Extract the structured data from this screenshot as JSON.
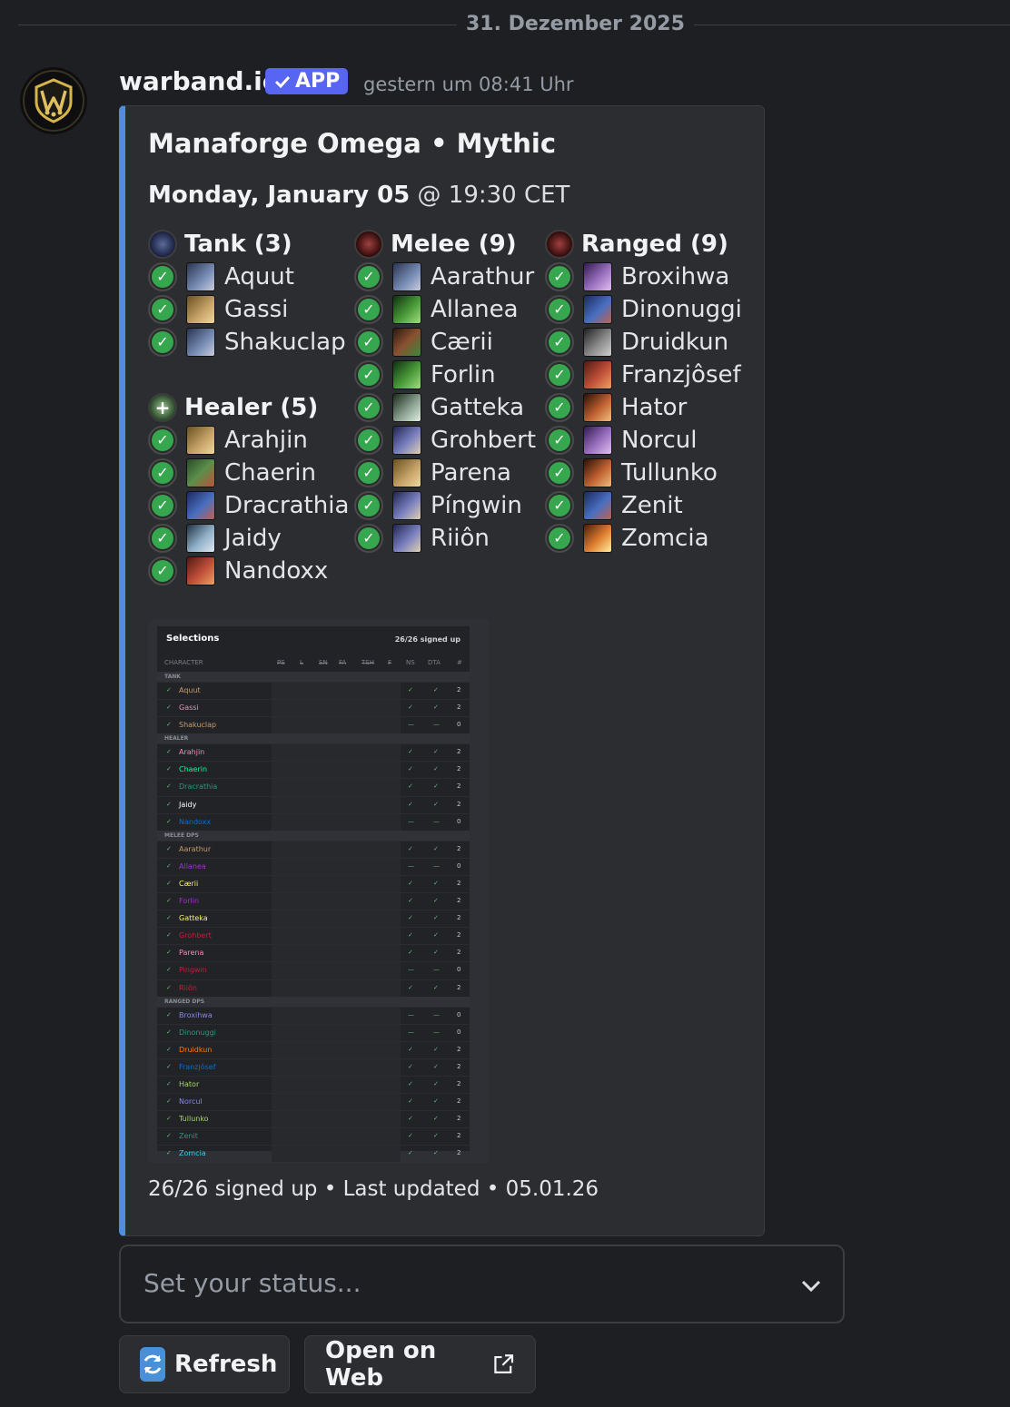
{
  "date_divider": "31. Dezember 2025",
  "message": {
    "author": "warband.io",
    "app_badge": "APP",
    "timestamp": "gestern um 08:41 Uhr"
  },
  "embed": {
    "accent_color": "#4e8ee0",
    "title": "Manaforge Omega • Mythic",
    "date_bold": "Monday, January 05",
    "date_rest": " @ 19:30 CET",
    "columns": [
      {
        "groups": [
          {
            "label": "Tank (3)",
            "icon": "shield-icon",
            "members": [
              {
                "name": "Aquut",
                "spec_color": "#7a8fb8"
              },
              {
                "name": "Gassi",
                "spec_color": "#c9a66b"
              },
              {
                "name": "Shakuclap",
                "spec_color": "#7a8fb8"
              }
            ]
          },
          {
            "label": "Healer (5)",
            "icon": "plus-icon",
            "members": [
              {
                "name": "Arahjin",
                "spec_color": "#c9a66b"
              },
              {
                "name": "Chaerin",
                "spec_color": "#5a8f4a"
              },
              {
                "name": "Dracrathia",
                "spec_color": "#4a6fc0"
              },
              {
                "name": "Jaidy",
                "spec_color": "#8fb0c8"
              },
              {
                "name": "Nandoxx",
                "spec_color": "#c0503a"
              }
            ]
          }
        ]
      },
      {
        "groups": [
          {
            "label": "Melee (9)",
            "icon": "sword-icon",
            "members": [
              {
                "name": "Aarathur",
                "spec_color": "#7a8fb8"
              },
              {
                "name": "Allanea",
                "spec_color": "#4a9a3a"
              },
              {
                "name": "Cærii",
                "spec_color": "#8a5030"
              },
              {
                "name": "Forlin",
                "spec_color": "#4a9a3a"
              },
              {
                "name": "Gatteka",
                "spec_color": "#8aa090"
              },
              {
                "name": "Grohbert",
                "spec_color": "#7a80c0"
              },
              {
                "name": "Parena",
                "spec_color": "#c9a66b"
              },
              {
                "name": "Píngwin",
                "spec_color": "#7a80c0"
              },
              {
                "name": "Riiôn",
                "spec_color": "#7a80c0"
              }
            ]
          }
        ]
      },
      {
        "groups": [
          {
            "label": "Ranged (9)",
            "icon": "staff-icon",
            "members": [
              {
                "name": "Broxihwa",
                "spec_color": "#9a70c0"
              },
              {
                "name": "Dinonuggi",
                "spec_color": "#4a6fc0"
              },
              {
                "name": "Druidkun",
                "spec_color": "#8a8a8a"
              },
              {
                "name": "Franzjôsef",
                "spec_color": "#c0503a"
              },
              {
                "name": "Hator",
                "spec_color": "#c06030"
              },
              {
                "name": "Norcul",
                "spec_color": "#9a70c0"
              },
              {
                "name": "Tullunko",
                "spec_color": "#c06030"
              },
              {
                "name": "Zenit",
                "spec_color": "#4a6fc0"
              },
              {
                "name": "Zomcia",
                "spec_color": "#e08030"
              }
            ]
          }
        ]
      }
    ],
    "selections": {
      "title": "Selections",
      "count": "26/26 signed up",
      "headers": [
        "CHARACTER",
        "PS",
        "L",
        "SN",
        "FA",
        "TSH",
        "F",
        "NS",
        "DTA",
        "#"
      ],
      "sections": [
        {
          "label": "TANK",
          "rows": [
            {
              "name": "Aquut",
              "color": "#c69b6d",
              "ns": "✓",
              "dta": "✓",
              "n": "2"
            },
            {
              "name": "Gassi",
              "color": "#f48cba",
              "ns": "✓",
              "dta": "✓",
              "n": "2"
            },
            {
              "name": "Shakuclap",
              "color": "#c69b6d",
              "ns": "—",
              "dta": "—",
              "n": "0"
            }
          ]
        },
        {
          "label": "HEALER",
          "rows": [
            {
              "name": "Arahjin",
              "color": "#f48cba",
              "ns": "✓",
              "dta": "✓",
              "n": "2"
            },
            {
              "name": "Chaerin",
              "color": "#00ff98",
              "ns": "✓",
              "dta": "✓",
              "n": "2"
            },
            {
              "name": "Dracrathia",
              "color": "#33937f",
              "ns": "✓",
              "dta": "✓",
              "n": "2"
            },
            {
              "name": "Jaidy",
              "color": "#ffffff",
              "ns": "✓",
              "dta": "✓",
              "n": "2"
            },
            {
              "name": "Nandoxx",
              "color": "#0070dd",
              "ns": "—",
              "dta": "—",
              "n": "0"
            }
          ]
        },
        {
          "label": "MELEE DPS",
          "rows": [
            {
              "name": "Aarathur",
              "color": "#c69b6d",
              "ns": "✓",
              "dta": "✓",
              "n": "2"
            },
            {
              "name": "Allanea",
              "color": "#a330c9",
              "ns": "—",
              "dta": "—",
              "n": "0"
            },
            {
              "name": "Cærii",
              "color": "#fff468",
              "ns": "✓",
              "dta": "✓",
              "n": "2"
            },
            {
              "name": "Forlin",
              "color": "#a330c9",
              "ns": "✓",
              "dta": "✓",
              "n": "2"
            },
            {
              "name": "Gatteka",
              "color": "#fff468",
              "ns": "✓",
              "dta": "✓",
              "n": "2"
            },
            {
              "name": "Grohbert",
              "color": "#c41e3a",
              "ns": "✓",
              "dta": "✓",
              "n": "2"
            },
            {
              "name": "Parena",
              "color": "#f48cba",
              "ns": "✓",
              "dta": "✓",
              "n": "2"
            },
            {
              "name": "Pingwin",
              "color": "#c41e3a",
              "ns": "—",
              "dta": "—",
              "n": "0"
            },
            {
              "name": "Riiôn",
              "color": "#c41e3a",
              "ns": "✓",
              "dta": "✓",
              "n": "2"
            }
          ]
        },
        {
          "label": "RANGED DPS",
          "rows": [
            {
              "name": "Broxihwa",
              "color": "#8788ee",
              "ns": "—",
              "dta": "—",
              "n": "0"
            },
            {
              "name": "Dinonuggi",
              "color": "#33937f",
              "ns": "—",
              "dta": "—",
              "n": "0"
            },
            {
              "name": "Druidkun",
              "color": "#ff7c0a",
              "ns": "✓",
              "dta": "✓",
              "n": "2"
            },
            {
              "name": "Franzjôsef",
              "color": "#0070dd",
              "ns": "✓",
              "dta": "✓",
              "n": "2"
            },
            {
              "name": "Hator",
              "color": "#aad372",
              "ns": "✓",
              "dta": "✓",
              "n": "2"
            },
            {
              "name": "Norcul",
              "color": "#8788ee",
              "ns": "✓",
              "dta": "✓",
              "n": "2"
            },
            {
              "name": "Tullunko",
              "color": "#aad372",
              "ns": "✓",
              "dta": "✓",
              "n": "2"
            },
            {
              "name": "Zenit",
              "color": "#33937f",
              "ns": "✓",
              "dta": "✓",
              "n": "2"
            },
            {
              "name": "Zomcia",
              "color": "#3fc7eb",
              "ns": "✓",
              "dta": "✓",
              "n": "2"
            }
          ]
        }
      ]
    },
    "footer": "26/26 signed up • Last updated • 05.01.26"
  },
  "status_select": {
    "placeholder": "Set your status..."
  },
  "buttons": {
    "refresh": "Refresh",
    "open_web": "Open on Web"
  }
}
